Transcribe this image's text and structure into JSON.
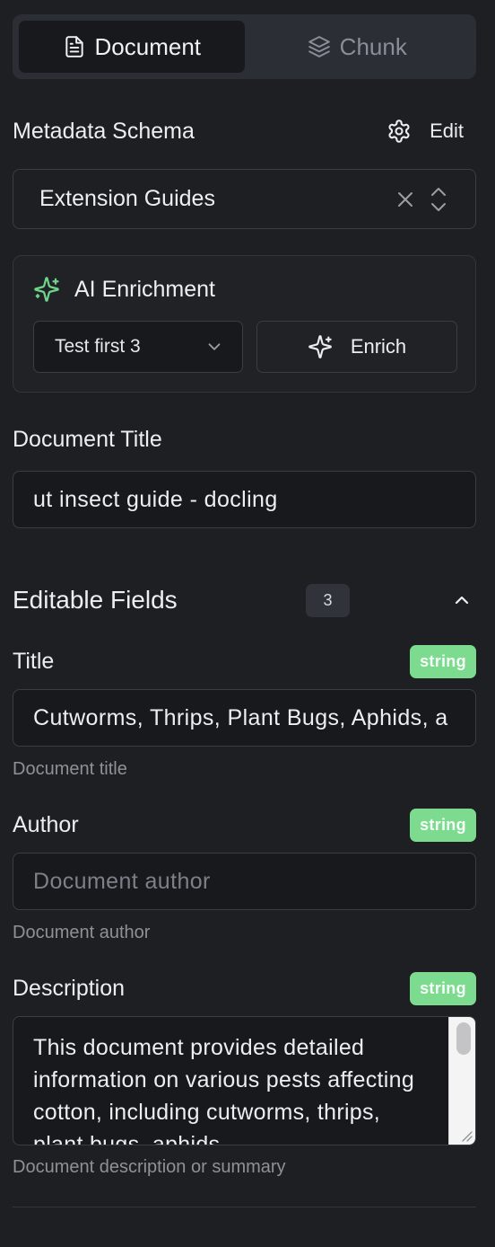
{
  "tabs": [
    {
      "label": "Document",
      "icon": "file-text-icon",
      "active": true
    },
    {
      "label": "Chunk",
      "icon": "layers-icon",
      "active": false
    }
  ],
  "schema": {
    "title": "Metadata Schema",
    "edit_label": "Edit",
    "selected": "Extension Guides"
  },
  "ai": {
    "title": "AI Enrichment",
    "mode": "Test first 3",
    "enrich_label": "Enrich",
    "accent": "#6fd58a"
  },
  "document_title": {
    "label": "Document Title",
    "value": "ut insect guide - docling"
  },
  "fields": {
    "title": "Editable Fields",
    "count": "3",
    "items": [
      {
        "label": "Title",
        "type": "string",
        "value": "Cutworms, Thrips, Plant Bugs, Aphids, a",
        "placeholder": "",
        "help": "Document title"
      },
      {
        "label": "Author",
        "type": "string",
        "value": "",
        "placeholder": "Document author",
        "help": "Document author"
      },
      {
        "label": "Description",
        "type": "string",
        "value": "This document provides detailed information on various pests affecting cotton, including cutworms, thrips, plant bugs, aphids",
        "help": "Document description or summary"
      }
    ]
  },
  "colors": {
    "background": "#1d1f23",
    "badge": "#7ddb8f"
  }
}
